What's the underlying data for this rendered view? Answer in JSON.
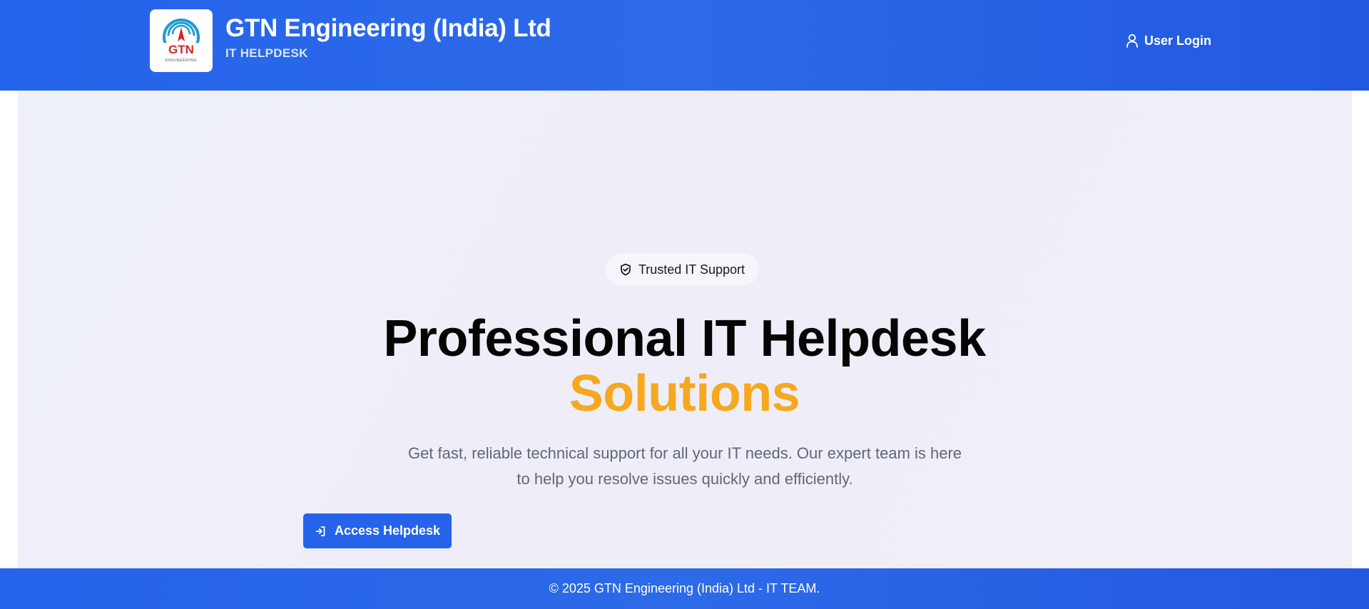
{
  "header": {
    "logo_text": "GTN",
    "logo_subtext": "ENGINEERING",
    "title": "GTN Engineering (India) Ltd",
    "subtitle": "IT HELPDESK",
    "login_icon": "user-icon",
    "login_label": "User Login"
  },
  "hero": {
    "badge_icon": "shield-check-icon",
    "badge_label": "Trusted IT Support",
    "headline": "Professional IT Helpdesk",
    "headline_accent": "Solutions",
    "description": "Get fast, reliable technical support for all your IT needs. Our expert team is here to help you resolve issues quickly and efficiently.",
    "cta_icon": "login-icon",
    "cta_label": "Access Helpdesk"
  },
  "footer": {
    "text": "© 2025 GTN Engineering (India) Ltd - IT TEAM."
  },
  "colors": {
    "primary": "#2563eb",
    "accent": "#f6a81f",
    "logo_red": "#d7262e",
    "logo_blue": "#1e9ad6"
  }
}
